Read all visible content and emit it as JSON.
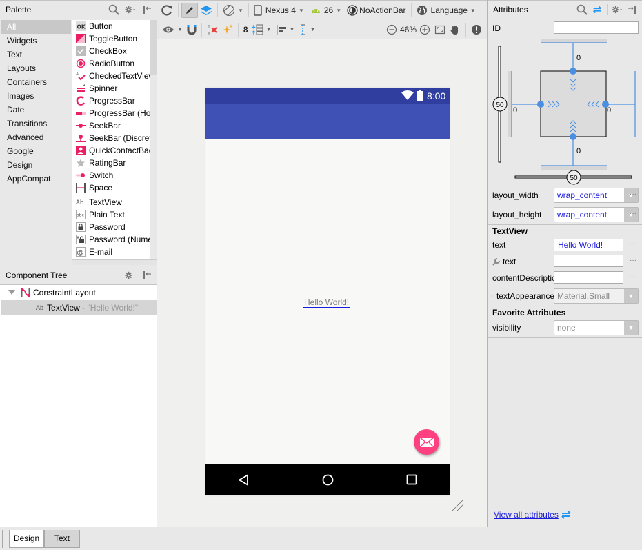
{
  "palette": {
    "title": "Palette",
    "categories": [
      "All",
      "Widgets",
      "Text",
      "Layouts",
      "Containers",
      "Images",
      "Date",
      "Transitions",
      "Advanced",
      "Google",
      "Design",
      "AppCompat"
    ],
    "selected_category": "All",
    "widgets": [
      {
        "label": "Button",
        "icon": "ok-button-icon"
      },
      {
        "label": "ToggleButton",
        "icon": "toggle-button-icon"
      },
      {
        "label": "CheckBox",
        "icon": "checkbox-icon"
      },
      {
        "label": "RadioButton",
        "icon": "radio-button-icon"
      },
      {
        "label": "CheckedTextView",
        "icon": "checked-text-view-icon"
      },
      {
        "label": "Spinner",
        "icon": "spinner-icon"
      },
      {
        "label": "ProgressBar",
        "icon": "progress-bar-icon"
      },
      {
        "label": "ProgressBar (Horizontal)",
        "icon": "progress-bar-horizontal-icon"
      },
      {
        "label": "SeekBar",
        "icon": "seekbar-icon"
      },
      {
        "label": "SeekBar (Discrete)",
        "icon": "seekbar-discrete-icon"
      },
      {
        "label": "QuickContactBadge",
        "icon": "quick-contact-badge-icon"
      },
      {
        "label": "RatingBar",
        "icon": "rating-bar-icon"
      },
      {
        "label": "Switch",
        "icon": "switch-icon"
      },
      {
        "label": "Space",
        "icon": "space-icon"
      }
    ],
    "text_widgets": [
      {
        "label": "TextView",
        "icon": "textview-icon"
      },
      {
        "label": "Plain Text",
        "icon": "plain-text-icon"
      },
      {
        "label": "Password",
        "icon": "password-icon"
      },
      {
        "label": "Password (Numeric)",
        "icon": "password-numeric-icon"
      },
      {
        "label": "E-mail",
        "icon": "email-icon"
      }
    ]
  },
  "component_tree": {
    "title": "Component Tree",
    "root": {
      "label": "ConstraintLayout"
    },
    "child": {
      "type": "TextView",
      "text": " - \"Hello World!\""
    }
  },
  "toolbar": {
    "device": "Nexus 4",
    "api_level": "26",
    "theme": "NoActionBar",
    "language": "Language",
    "margin_default": "8",
    "zoom_level": "46%"
  },
  "device_preview": {
    "status_time": "8:00",
    "hello_text": "Hello World!",
    "colors": {
      "status_bar": "#303f9f",
      "app_bar": "#3f51b5",
      "fab": "#ff4081",
      "nav_bar": "#000000"
    }
  },
  "attributes": {
    "title": "Attributes",
    "id_label": "ID",
    "id_value": "",
    "constraints": {
      "top_margin": "0",
      "bottom_margin": "0",
      "left_margin": "0",
      "right_margin": "0",
      "vertical_bias": "50",
      "horizontal_bias": "50"
    },
    "layout_width": {
      "label": "layout_width",
      "value": "wrap_content"
    },
    "layout_height": {
      "label": "layout_height",
      "value": "wrap_content"
    },
    "textview_section": "TextView",
    "text": {
      "label": "text",
      "value": "Hello World!"
    },
    "tools_text": {
      "label": "text",
      "value": ""
    },
    "content_description": {
      "label": "contentDescription",
      "value": ""
    },
    "text_appearance": {
      "label": "textAppearance",
      "value": "Material.Small"
    },
    "favorites_section": "Favorite Attributes",
    "visibility": {
      "label": "visibility",
      "value": "none"
    },
    "view_all_link": "View all attributes"
  },
  "bottom_tabs": [
    {
      "label": "Design",
      "active": true
    },
    {
      "label": "Text",
      "active": false
    }
  ]
}
